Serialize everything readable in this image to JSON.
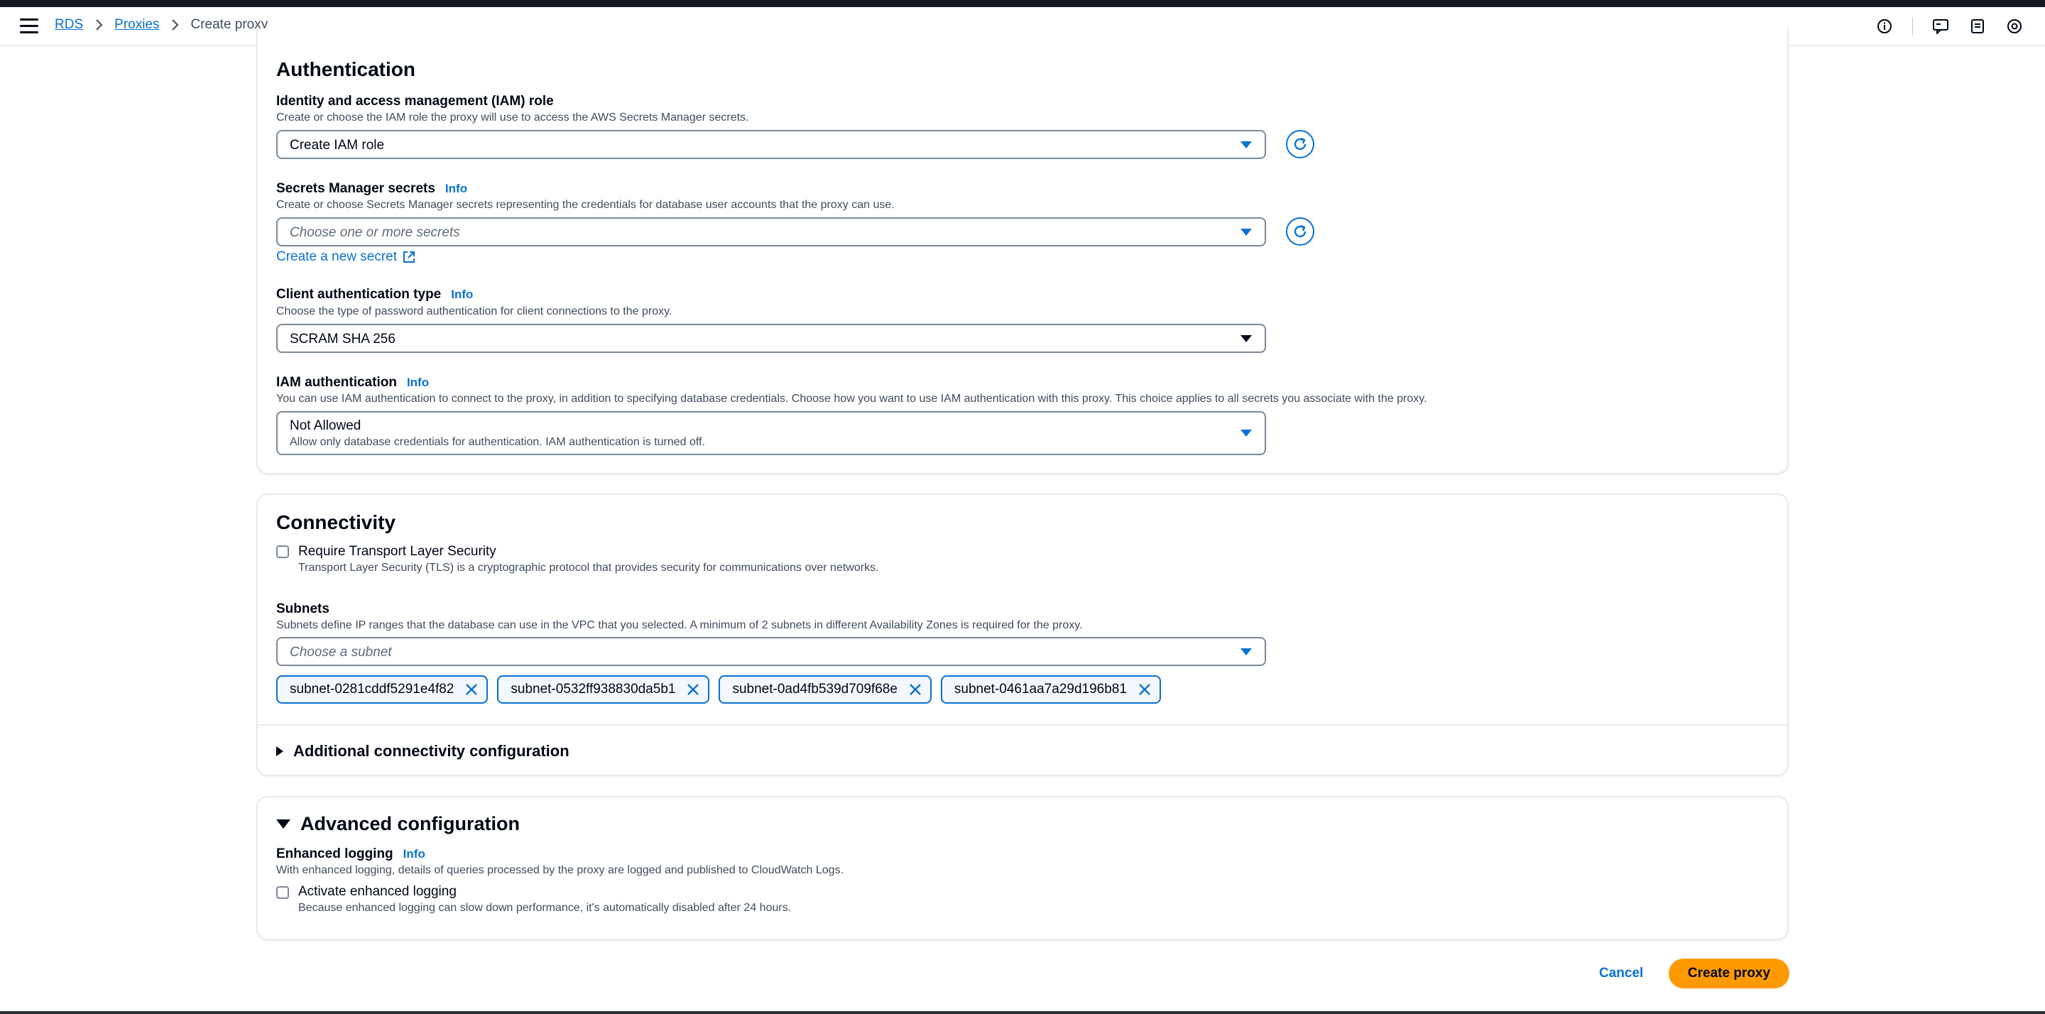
{
  "breadcrumb": {
    "root": "RDS",
    "parent": "Proxies",
    "current": "Create proxy"
  },
  "topbar": {
    "icons": [
      "info-icon",
      "feedback-icon",
      "notes-icon",
      "settings-icon"
    ]
  },
  "auth": {
    "title": "Authentication",
    "iam_role": {
      "label": "Identity and access management (IAM) role",
      "desc": "Create or choose the IAM role the proxy will use to access the AWS Secrets Manager secrets.",
      "value": "Create IAM role"
    },
    "secrets": {
      "label": "Secrets Manager secrets",
      "info": "Info",
      "desc": "Create or choose Secrets Manager secrets representing the credentials for database user accounts that the proxy can use.",
      "placeholder": "Choose one or more secrets",
      "create_link": "Create a new secret"
    },
    "client_auth": {
      "label": "Client authentication type",
      "info": "Info",
      "desc": "Choose the type of password authentication for client connections to the proxy.",
      "value": "SCRAM SHA 256"
    },
    "iam_auth": {
      "label": "IAM authentication",
      "info": "Info",
      "desc": "You can use IAM authentication to connect to the proxy, in addition to specifying database credentials. Choose how you want to use IAM authentication with this proxy. This choice applies to all secrets you associate with the proxy.",
      "value": "Not Allowed",
      "value_desc": "Allow only database credentials for authentication. IAM authentication is turned off."
    }
  },
  "connectivity": {
    "title": "Connectivity",
    "tls": {
      "label": "Require Transport Layer Security",
      "desc": "Transport Layer Security (TLS) is a cryptographic protocol that provides security for communications over networks.",
      "checked": false
    },
    "subnets": {
      "label": "Subnets",
      "desc": "Subnets define IP ranges that the database can use in the VPC that you selected. A minimum of 2 subnets in different Availability Zones is required for the proxy.",
      "placeholder": "Choose a subnet",
      "tokens": [
        "subnet-0281cddf5291e4f82",
        "subnet-0532ff938830da5b1",
        "subnet-0ad4fb539d709f68e",
        "subnet-0461aa7a29d196b81"
      ]
    },
    "additional": "Additional connectivity configuration"
  },
  "advanced": {
    "title": "Advanced configuration",
    "logging": {
      "label": "Enhanced logging",
      "info": "Info",
      "desc": "With enhanced logging, details of queries processed by the proxy are logged and published to CloudWatch Logs.",
      "checkbox_label": "Activate enhanced logging",
      "checkbox_desc": "Because enhanced logging can slow down performance, it's automatically disabled after 24 hours.",
      "checked": false
    }
  },
  "actions": {
    "cancel": "Cancel",
    "create": "Create proxy"
  },
  "colors": {
    "link": "#0972d3",
    "primary": "#ff9900",
    "text": "#000716",
    "muted": "#414d5c",
    "border": "#7d8998"
  }
}
